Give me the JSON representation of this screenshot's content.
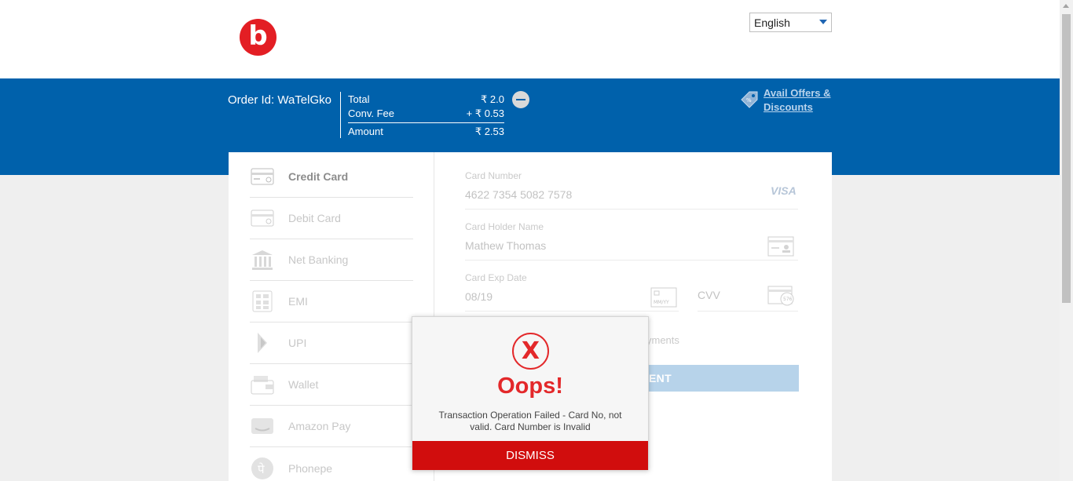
{
  "header": {
    "logo_letter": "b",
    "language": {
      "selected": "English"
    }
  },
  "order": {
    "order_id_label": "Order Id: WaTelGko",
    "rows": [
      {
        "label": "Total",
        "value": "₹ 2.0"
      },
      {
        "label": "Conv. Fee",
        "value": "+ ₹ 0.53"
      },
      {
        "label": "Amount",
        "value": "₹ 2.53"
      }
    ],
    "offers_link": [
      "Avail Offers &",
      "Discounts"
    ]
  },
  "sidebar": {
    "items": [
      {
        "label": "Credit Card",
        "icon": "credit-card-icon",
        "active": true
      },
      {
        "label": "Debit Card",
        "icon": "debit-card-icon",
        "active": false
      },
      {
        "label": "Net Banking",
        "icon": "bank-icon",
        "active": false
      },
      {
        "label": "EMI",
        "icon": "calculator-icon",
        "active": false
      },
      {
        "label": "UPI",
        "icon": "upi-icon",
        "active": false
      },
      {
        "label": "Wallet",
        "icon": "wallet-icon",
        "active": false
      },
      {
        "label": "Amazon Pay",
        "icon": "amazon-pay-icon",
        "active": false
      },
      {
        "label": "Phonepe",
        "icon": "phonepe-icon",
        "active": false
      }
    ]
  },
  "form": {
    "card_number": {
      "label": "Card Number",
      "value": "4622 7354 5082 7578",
      "brand": "VISA"
    },
    "holder": {
      "label": "Card Holder Name",
      "value": "Mathew Thomas"
    },
    "expiry": {
      "label": "Card Exp Date",
      "value": "08/19"
    },
    "cvv": {
      "placeholder": "CVV"
    },
    "save_partial": "yments",
    "pay_button_partial": "MENT"
  },
  "modal": {
    "icon_letter": "X",
    "title": "Oops!",
    "message": "Transaction Operation Failed - Card No, not valid. Card Number is Invalid",
    "dismiss_label": "DISMISS"
  },
  "colors": {
    "brand_blue": "#0061ab",
    "error_red": "#e3282a",
    "dismiss_red": "#d10d0d"
  }
}
